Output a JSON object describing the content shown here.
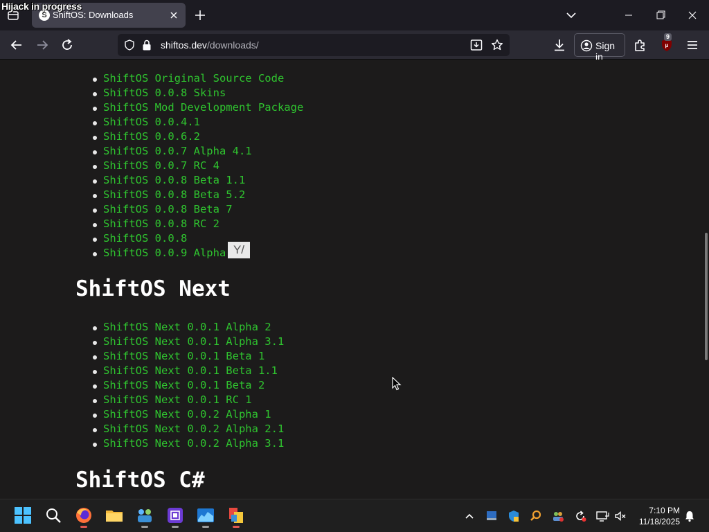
{
  "overlay": {
    "hijack_text": "Hijack in progress"
  },
  "tab": {
    "title": "ShiftOS: Downloads",
    "favicon_letter": "S"
  },
  "urlbar": {
    "host": "shiftos.dev",
    "path": "/downloads/"
  },
  "toolbar": {
    "signin_label": "Sign in",
    "ublock_badge": "9"
  },
  "page": {
    "list1": [
      "ShiftOS Original Source Code",
      "ShiftOS 0.0.8 Skins",
      "ShiftOS Mod Development Package",
      "ShiftOS 0.0.4.1",
      "ShiftOS 0.0.6.2",
      "ShiftOS 0.0.7 Alpha 4.1",
      "ShiftOS 0.0.7 RC 4",
      "ShiftOS 0.0.8 Beta 1.1",
      "ShiftOS 0.0.8 Beta 5.2",
      "ShiftOS 0.0.8 Beta 7",
      "ShiftOS 0.0.8 RC 2",
      "ShiftOS 0.0.8",
      "ShiftOS 0.0.9 Alpha"
    ],
    "heading_next": "ShiftOS Next",
    "list2": [
      "ShiftOS Next 0.0.1 Alpha 2",
      "ShiftOS Next 0.0.1 Alpha 3.1",
      "ShiftOS Next 0.0.1 Beta 1",
      "ShiftOS Next 0.0.1 Beta 1.1",
      "ShiftOS Next 0.0.1 Beta 2",
      "ShiftOS Next 0.0.1 RC 1",
      "ShiftOS Next 0.0.2 Alpha 1",
      "ShiftOS Next 0.0.2 Alpha 2.1",
      "ShiftOS Next 0.0.2 Alpha 3.1"
    ],
    "heading_csharp": "ShiftOS C#",
    "tooltip_text": "Y/"
  },
  "taskbar": {
    "time": "7:10 PM",
    "date": "11/18/2025"
  },
  "colors": {
    "link_green": "#2fc42f",
    "page_bg": "#1c1b1b",
    "tab_active": "#42414d",
    "toolbar_bg": "#2b2a33"
  }
}
